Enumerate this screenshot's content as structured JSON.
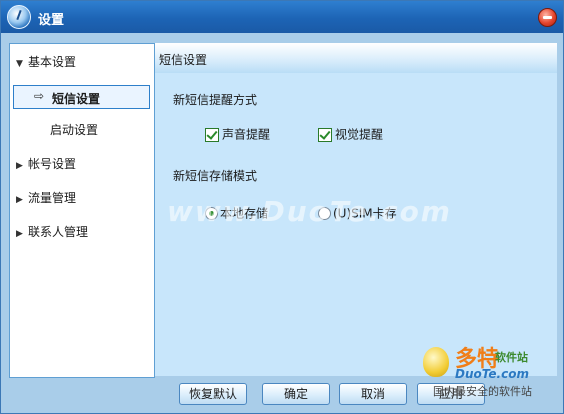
{
  "window": {
    "title": "设置"
  },
  "sidebar": {
    "items": [
      {
        "label": "基本设置",
        "expanded": true
      },
      {
        "label": "短信设置",
        "selected": true,
        "prefix": "⇨"
      },
      {
        "label": "启动设置"
      },
      {
        "label": "帐号设置",
        "expanded": false
      },
      {
        "label": "流量管理",
        "expanded": false
      },
      {
        "label": "联系人管理",
        "expanded": false
      }
    ]
  },
  "main": {
    "section_title": "短信设置",
    "alert_group": {
      "label": "新短信提醒方式",
      "options": [
        {
          "label": "声音提醒",
          "checked": true
        },
        {
          "label": "视觉提醒",
          "checked": true
        }
      ]
    },
    "storage_group": {
      "label": "新短信存储模式",
      "options": [
        {
          "label": "本地存储",
          "selected": true
        },
        {
          "label": "(U)SIM卡存",
          "selected": false
        }
      ]
    }
  },
  "buttons": {
    "restore": "恢复默认",
    "ok": "确定",
    "cancel": "取消",
    "apply": "应用"
  },
  "watermark": {
    "text": "www.DuoTe.com"
  },
  "branding": {
    "big": "多特",
    "small": "软件站",
    "url": "DuoTe.com",
    "slogan": "国内最安全的软件站"
  },
  "colors": {
    "title_bar": "#1d64b5",
    "panel_bg": "#c8e6fb",
    "check_green": "#2a8a2a"
  }
}
